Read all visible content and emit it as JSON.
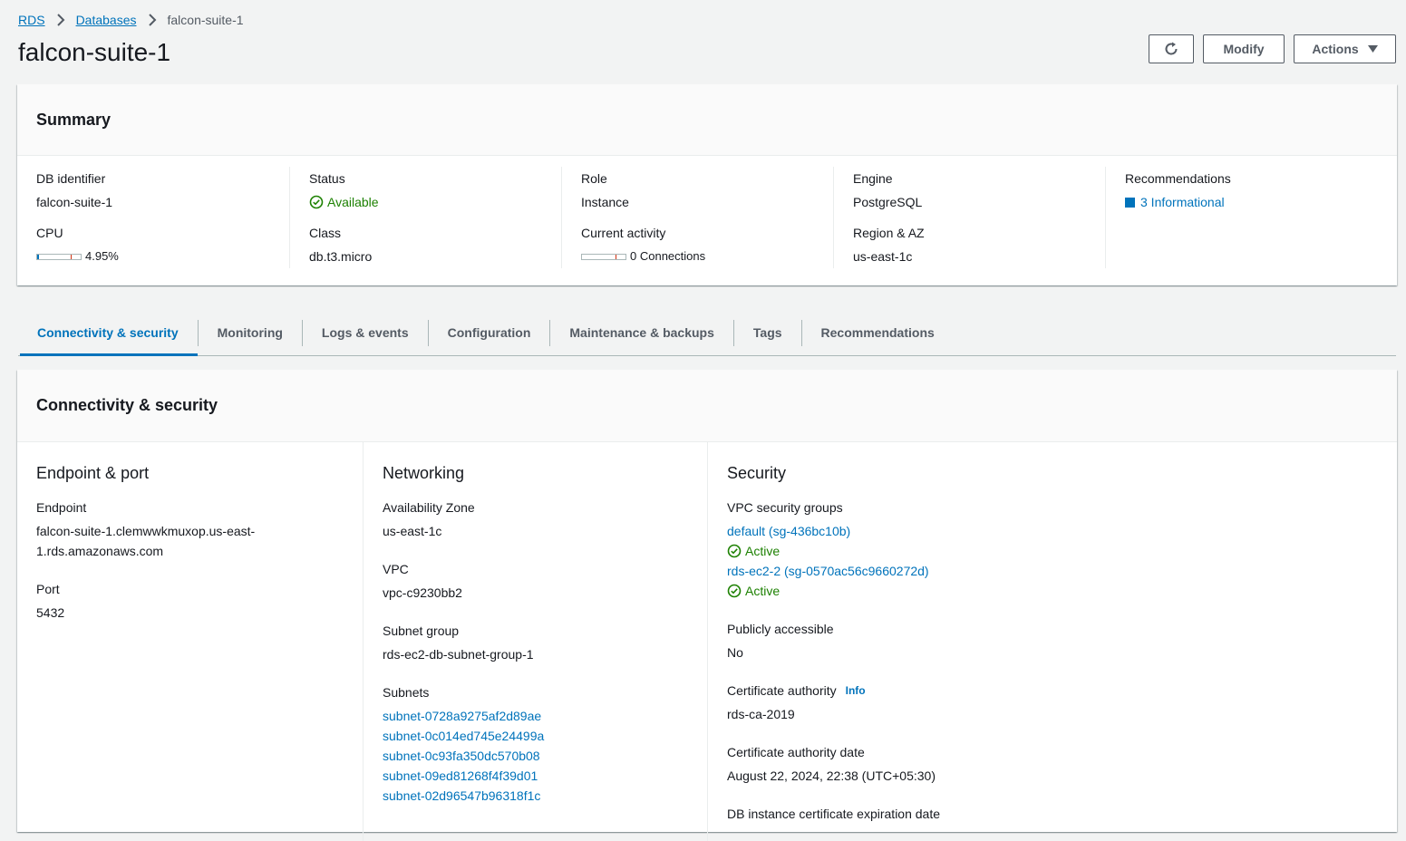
{
  "breadcrumb": {
    "root": "RDS",
    "section": "Databases",
    "current": "falcon-suite-1"
  },
  "page": {
    "title": "falcon-suite-1"
  },
  "header_actions": {
    "modify_label": "Modify",
    "actions_label": "Actions"
  },
  "summary": {
    "title": "Summary",
    "db_identifier": {
      "label": "DB identifier",
      "value": "falcon-suite-1"
    },
    "cpu": {
      "label": "CPU",
      "value": "4.95%",
      "fraction": 0.0495
    },
    "status": {
      "label": "Status",
      "value": "Available"
    },
    "class": {
      "label": "Class",
      "value": "db.t3.micro"
    },
    "role": {
      "label": "Role",
      "value": "Instance"
    },
    "current_activity": {
      "label": "Current activity",
      "value": "0 Connections"
    },
    "engine": {
      "label": "Engine",
      "value": "PostgreSQL"
    },
    "region_az": {
      "label": "Region & AZ",
      "value": "us-east-1c"
    },
    "recommendations": {
      "label": "Recommendations",
      "value": "3 Informational"
    }
  },
  "tabs": [
    {
      "label": "Connectivity & security",
      "active": true
    },
    {
      "label": "Monitoring"
    },
    {
      "label": "Logs & events"
    },
    {
      "label": "Configuration"
    },
    {
      "label": "Maintenance & backups"
    },
    {
      "label": "Tags"
    },
    {
      "label": "Recommendations"
    }
  ],
  "connectivity": {
    "title": "Connectivity & security",
    "endpoint_port": {
      "title": "Endpoint & port",
      "endpoint_label": "Endpoint",
      "endpoint_value": "falcon-suite-1.clemwwkmuxop.us-east-1.rds.amazonaws.com",
      "port_label": "Port",
      "port_value": "5432"
    },
    "networking": {
      "title": "Networking",
      "az_label": "Availability Zone",
      "az_value": "us-east-1c",
      "vpc_label": "VPC",
      "vpc_value": "vpc-c9230bb2",
      "subnet_group_label": "Subnet group",
      "subnet_group_value": "rds-ec2-db-subnet-group-1",
      "subnets_label": "Subnets",
      "subnets": [
        "subnet-0728a9275af2d89ae",
        "subnet-0c014ed745e24499a",
        "subnet-0c93fa350dc570b08",
        "subnet-09ed81268f4f39d01",
        "subnet-02d96547b96318f1c"
      ]
    },
    "security": {
      "title": "Security",
      "vpc_sg_label": "VPC security groups",
      "security_groups": [
        {
          "name": "default (sg-436bc10b)",
          "status": "Active"
        },
        {
          "name": "rds-ec2-2 (sg-0570ac56c9660272d)",
          "status": "Active"
        }
      ],
      "public_label": "Publicly accessible",
      "public_value": "No",
      "ca_label": "Certificate authority",
      "ca_info": "Info",
      "ca_value": "rds-ca-2019",
      "ca_date_label": "Certificate authority date",
      "ca_date_value": "August 22, 2024, 22:38 (UTC+05:30)",
      "expiry_label": "DB instance certificate expiration date"
    }
  },
  "colors": {
    "link": "#0073bb",
    "success": "#1d8102",
    "text": "#16191f",
    "background": "#f2f3f3"
  }
}
